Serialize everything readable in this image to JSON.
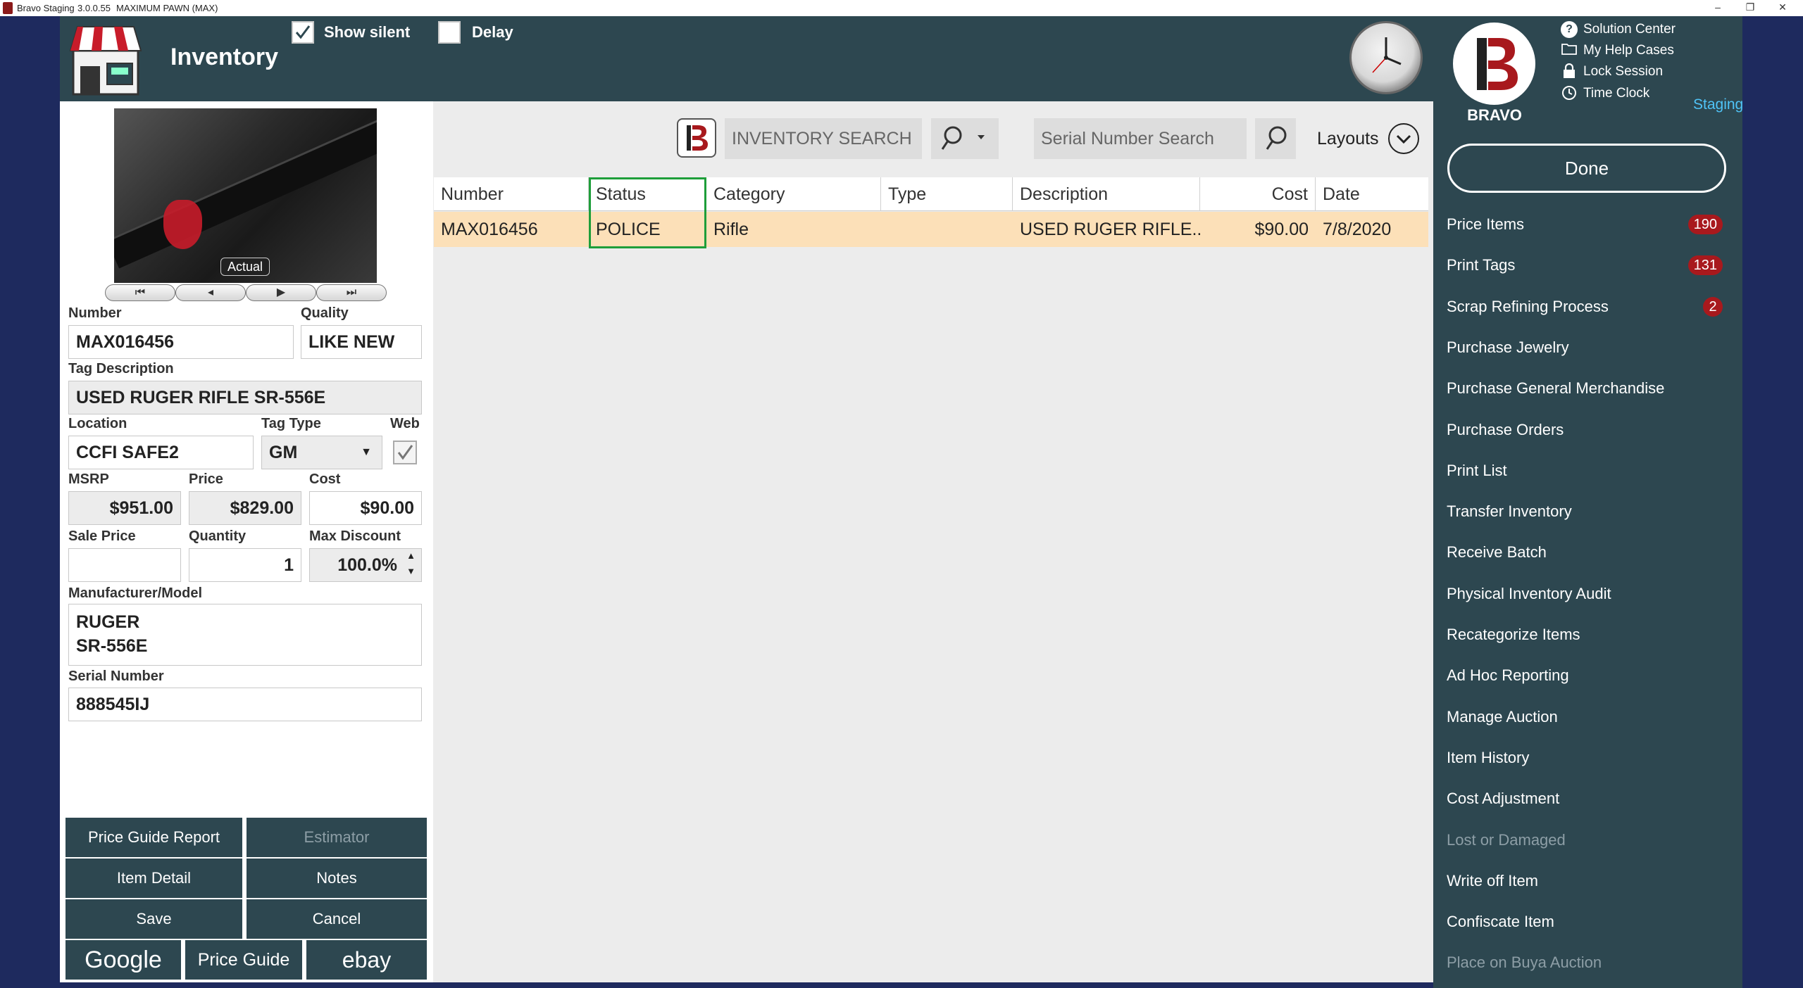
{
  "window": {
    "app_name": "Bravo Staging",
    "version": "3.0.0.55",
    "store": "MAXIMUM PAWN (MAX)",
    "minimize": "–",
    "restore": "❐",
    "close": "✕"
  },
  "header": {
    "title": "Inventory",
    "show_silent_label": "Show silent",
    "show_silent_checked": true,
    "delay_label": "Delay",
    "delay_checked": false
  },
  "right_panel": {
    "brand": "BRAVO",
    "links": [
      {
        "label": "Solution Center",
        "icon": "question-icon"
      },
      {
        "label": "My Help Cases",
        "icon": "folder-icon"
      },
      {
        "label": "Lock Session",
        "icon": "lock-icon"
      },
      {
        "label": "Time Clock",
        "icon": "clock-icon"
      }
    ],
    "environment": "Staging",
    "done_label": "Done",
    "menu": [
      {
        "label": "Price Items",
        "badge": "190",
        "enabled": true
      },
      {
        "label": "Print Tags",
        "badge": "131",
        "enabled": true
      },
      {
        "label": "Scrap Refining Process",
        "badge": "2",
        "enabled": true
      },
      {
        "label": "Purchase Jewelry",
        "badge": "",
        "enabled": true
      },
      {
        "label": "Purchase General Merchandise",
        "badge": "",
        "enabled": true
      },
      {
        "label": "Purchase Orders",
        "badge": "",
        "enabled": true
      },
      {
        "label": "Print List",
        "badge": "",
        "enabled": true
      },
      {
        "label": "Transfer Inventory",
        "badge": "",
        "enabled": true
      },
      {
        "label": "Receive Batch",
        "badge": "",
        "enabled": true
      },
      {
        "label": "Physical Inventory Audit",
        "badge": "",
        "enabled": true
      },
      {
        "label": "Recategorize Items",
        "badge": "",
        "enabled": true
      },
      {
        "label": "Ad Hoc Reporting",
        "badge": "",
        "enabled": true
      },
      {
        "label": "Manage Auction",
        "badge": "",
        "enabled": true
      },
      {
        "label": "Item History",
        "badge": "",
        "enabled": true
      },
      {
        "label": "Cost Adjustment",
        "badge": "",
        "enabled": true
      },
      {
        "label": "Lost or Damaged",
        "badge": "",
        "enabled": false
      },
      {
        "label": "Write off Item",
        "badge": "",
        "enabled": true
      },
      {
        "label": "Confiscate Item",
        "badge": "",
        "enabled": true
      },
      {
        "label": "Place on Buya Auction",
        "badge": "",
        "enabled": false
      }
    ]
  },
  "item": {
    "photo_badge": "Actual",
    "photo_nav": {
      "first": "⏮",
      "prev": "◂",
      "next": "▶",
      "last": "⏭"
    },
    "number_label": "Number",
    "number": "MAX016456",
    "quality_label": "Quality",
    "quality": "LIKE NEW",
    "tag_desc_label": "Tag Description",
    "tag_desc": "USED RUGER RIFLE SR-556E",
    "location_label": "Location",
    "location": "CCFI SAFE2",
    "tag_type_label": "Tag Type",
    "tag_type": "GM",
    "web_label": "Web",
    "web_checked": true,
    "msrp_label": "MSRP",
    "msrp": "$951.00",
    "price_label": "Price",
    "price": "$829.00",
    "cost_label": "Cost",
    "cost": "$90.00",
    "sale_price_label": "Sale Price",
    "sale_price": "",
    "quantity_label": "Quantity",
    "quantity": "1",
    "max_discount_label": "Max Discount",
    "max_discount": "100.0%",
    "mfr_label": "Manufacturer/Model",
    "manufacturer": "RUGER",
    "model": "SR-556E",
    "serial_label": "Serial Number",
    "serial": "888545IJ"
  },
  "actions": {
    "price_guide_report": "Price Guide Report",
    "estimator": "Estimator",
    "item_detail": "Item Detail",
    "notes": "Notes",
    "save": "Save",
    "cancel": "Cancel",
    "google": "Google",
    "price_guide": "Price Guide",
    "ebay": "ebay"
  },
  "search": {
    "inventory_placeholder": "INVENTORY SEARCH",
    "serial_placeholder": "Serial Number Search",
    "layouts_label": "Layouts"
  },
  "grid": {
    "columns": [
      "Number",
      "Status",
      "Category",
      "Type",
      "Description",
      "Cost",
      "Date"
    ],
    "rows": [
      {
        "number": "MAX016456",
        "status": "POLICE",
        "category": "Rifle",
        "type": "",
        "description": "USED RUGER RIFLE...",
        "cost": "$90.00",
        "date": "7/8/2020"
      }
    ]
  },
  "colors": {
    "header_bg": "#2d4750",
    "band_bg": "#1e2a5e",
    "badge_red": "#a8191d",
    "selected_row": "#fce0b8",
    "status_highlight": "#1e9e3a",
    "staging_cyan": "#4fc3f7"
  }
}
